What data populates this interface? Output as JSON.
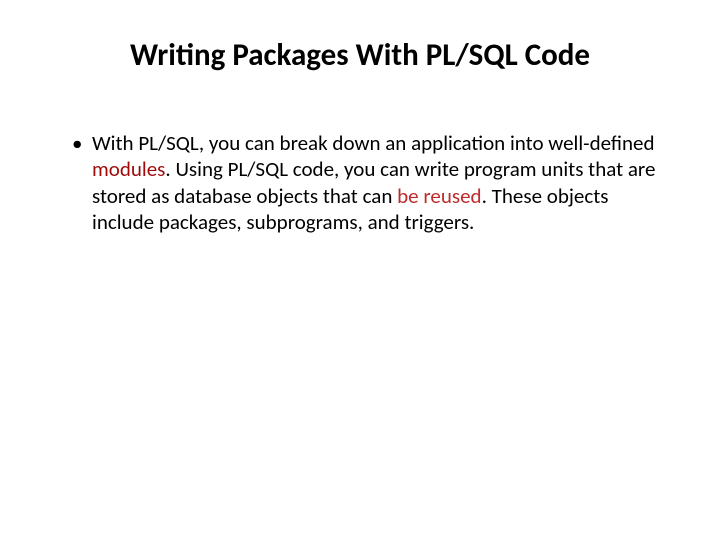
{
  "title": "Writing Packages With PL/SQL Code",
  "bullet": {
    "t1": "With PL/SQL, you can break down an application into well-defined ",
    "modules": "modules",
    "t2": ". Using PL/SQL code, you can write program units that are stored as database objects that can ",
    "reused": "be reused",
    "t3": ". These objects include packages, subprograms, and triggers."
  }
}
